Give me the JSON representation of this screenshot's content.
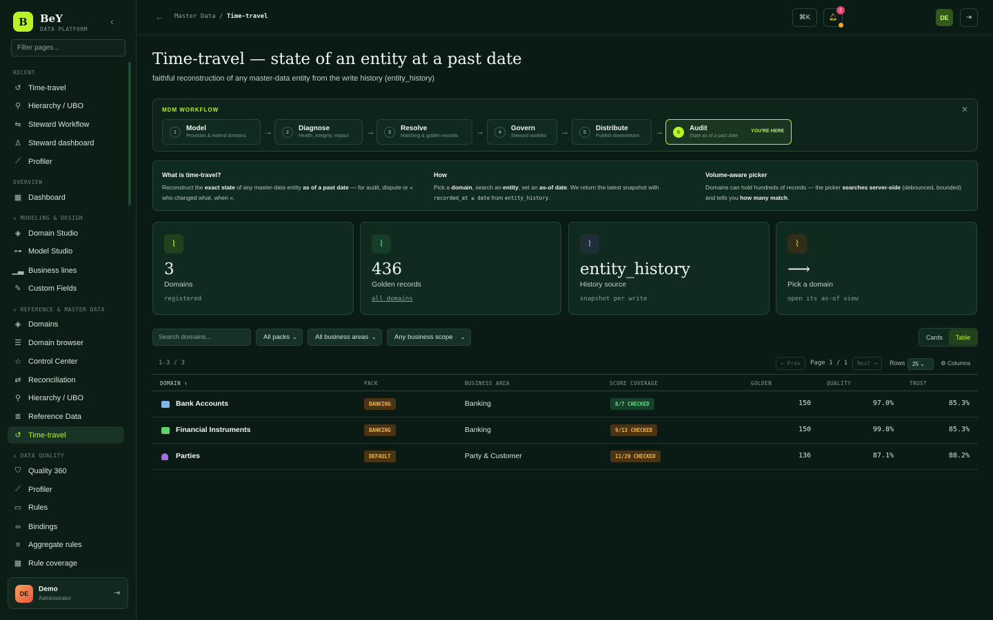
{
  "brand": {
    "initial": "B",
    "name": "BeY",
    "subtitle": "DATA PLATFORM"
  },
  "sidebar": {
    "filter_placeholder": "Filter pages...",
    "sections": [
      {
        "label": "RECENT"
      },
      {
        "label": "OVERVIEW"
      },
      {
        "label": "MODELING & DESIGN"
      },
      {
        "label": "REFERENCE & MASTER DATA"
      },
      {
        "label": "DATA QUALITY"
      }
    ],
    "items": [
      {
        "label": "Time-travel"
      },
      {
        "label": "Hierarchy / UBO"
      },
      {
        "label": "Steward Workflow"
      },
      {
        "label": "Steward dashboard"
      },
      {
        "label": "Profiler"
      },
      {
        "label": "Dashboard"
      },
      {
        "label": "Domain Studio"
      },
      {
        "label": "Model Studio"
      },
      {
        "label": "Business lines"
      },
      {
        "label": "Custom Fields"
      },
      {
        "label": "Domains"
      },
      {
        "label": "Domain browser"
      },
      {
        "label": "Control Center"
      },
      {
        "label": "Reconciliation"
      },
      {
        "label": "Hierarchy / UBO"
      },
      {
        "label": "Reference Data"
      },
      {
        "label": "Time-travel"
      },
      {
        "label": "Quality 360"
      },
      {
        "label": "Profiler"
      },
      {
        "label": "Rules"
      },
      {
        "label": "Bindings"
      },
      {
        "label": "Aggregate rules"
      },
      {
        "label": "Rule coverage"
      }
    ],
    "user": {
      "initials": "DE",
      "name": "Demo",
      "role": "Administrator"
    }
  },
  "topbar": {
    "breadcrumb_parent": "Master Data",
    "breadcrumb_sep": "/",
    "breadcrumb_current": "Time-travel",
    "shortcut": "⌘K",
    "notifications": "2",
    "lang": "DE"
  },
  "header": {
    "title": "Time-travel — state of an entity at a past date",
    "subtitle": "faithful reconstruction of any master-data entity from the write history (entity_history)"
  },
  "workflow": {
    "label": "MDM WORKFLOW",
    "steps": [
      {
        "num": "1",
        "title": "Model",
        "desc": "Provision & extend domains"
      },
      {
        "num": "2",
        "title": "Diagnose",
        "desc": "Health, integrity, impact"
      },
      {
        "num": "3",
        "title": "Resolve",
        "desc": "Matching & golden records"
      },
      {
        "num": "4",
        "title": "Govern",
        "desc": "Steward worklist"
      },
      {
        "num": "5",
        "title": "Distribute",
        "desc": "Publish downstream"
      },
      {
        "num": "6",
        "title": "Audit",
        "desc": "State as of a past date",
        "badge": "YOU'RE HERE"
      }
    ]
  },
  "info": {
    "what_title": "What is time-travel?",
    "what_1": "Reconstruct the ",
    "what_2": "exact state",
    "what_3": " of any master-data entity ",
    "what_4": "as of a past date",
    "what_5": " — for audit, dispute or « who changed what, when ».",
    "how_title": "How",
    "how_1": "Pick a ",
    "how_2": "domain",
    "how_3": ", search an ",
    "how_4": "entity",
    "how_5": ", set an ",
    "how_6": "as-of date",
    "how_7": ". We return the latest snapshot with ",
    "how_8": "recorded_at ≤ date",
    "how_9": " from ",
    "how_10": "entity_history",
    "how_11": ".",
    "vol_title": "Volume-aware picker",
    "vol_1": "Domains can hold hundreds of records — the picker ",
    "vol_2": "searches server-side",
    "vol_3": " (debounced, bounded) and tells you ",
    "vol_4": "how many match",
    "vol_5": "."
  },
  "kpis": [
    {
      "value": "3",
      "label": "Domains",
      "foot": "registered",
      "icon": "pulse-icon",
      "color": "#b9f227"
    },
    {
      "value": "436",
      "label": "Golden records",
      "foot": "all domains",
      "icon": "pulse-icon",
      "color": "#5fe08a"
    },
    {
      "value": "entity_history",
      "label": "History source",
      "foot": "snapshot per write",
      "icon": "pulse-icon",
      "color": "#a8a4ff"
    },
    {
      "value": "⟶",
      "label": "Pick a domain",
      "foot": "open its as-of view",
      "icon": "pulse-icon",
      "color": "#f2b54a"
    }
  ],
  "filters": {
    "search_placeholder": "Search domains...",
    "packs": "All packs",
    "areas": "All business areas",
    "scope": "Any business scope",
    "view_cards": "Cards",
    "view_table": "Table"
  },
  "pager": {
    "count": "1-3 / 3",
    "prev": "← Prev",
    "page": "Page 1 / 1",
    "next": "Next →",
    "rows_label": "Rows",
    "rows": "25",
    "columns": "⚙ Columns"
  },
  "table": {
    "headers": [
      "DOMAIN ↑",
      "PACK",
      "BUSINESS AREA",
      "SCORE COVERAGE",
      "GOLDEN",
      "QUALITY",
      "TRUST"
    ],
    "rows": [
      {
        "name": "Bank Accounts",
        "pack": "BANKING",
        "area": "Banking",
        "coverage": "8/7 CHECKED",
        "golden": "150",
        "quality": "97.0%",
        "trust": "85.3%",
        "flag": "#7fb6e8",
        "cov_color": "green"
      },
      {
        "name": "Financial Instruments",
        "pack": "BANKING",
        "area": "Banking",
        "coverage": "9/13 CHECKED",
        "golden": "150",
        "quality": "99.8%",
        "trust": "85.3%",
        "flag": "#5fd36a",
        "cov_color": "amber"
      },
      {
        "name": "Parties",
        "pack": "DEFAULT",
        "area": "Party & Customer",
        "coverage": "11/20 CHECKED",
        "golden": "136",
        "quality": "87.1%",
        "trust": "88.2%",
        "flag": "#a070e0",
        "cov_color": "amber"
      }
    ]
  }
}
